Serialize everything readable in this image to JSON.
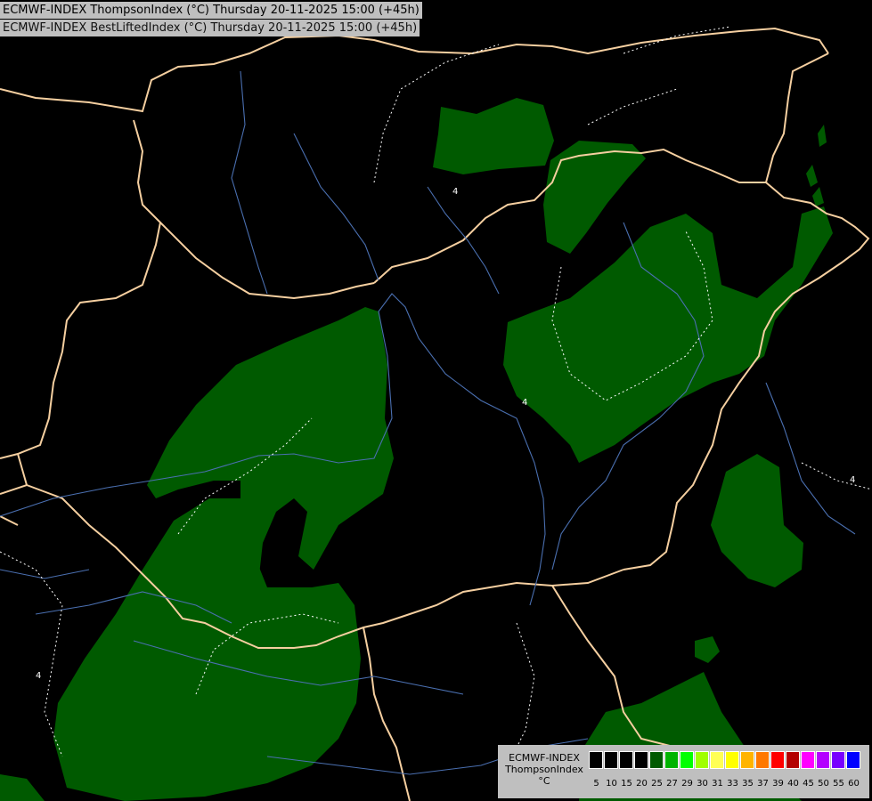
{
  "titles": {
    "line1": "ECMWF-INDEX ThompsonIndex (°C) Thursday 20-11-2025 15:00 (+45h)",
    "line2": "ECMWF-INDEX BestLiftedIndex (°C) Thursday 20-11-2025 15:00 (+45h)"
  },
  "legend": {
    "model": "ECMWF-INDEX",
    "variable": "ThompsonIndex",
    "unit": "°C",
    "ticks": [
      "5",
      "10",
      "15",
      "20",
      "25",
      "27",
      "29",
      "30",
      "31",
      "33",
      "35",
      "37",
      "39",
      "40",
      "45",
      "50",
      "55",
      "60"
    ],
    "colors": [
      "#000000",
      "#000000",
      "#000000",
      "#000000",
      "#005a00",
      "#00b400",
      "#00ff00",
      "#a0ff00",
      "#ffff55",
      "#ffff00",
      "#ffb400",
      "#ff7800",
      "#ff0000",
      "#b40000",
      "#ff00ff",
      "#b400ff",
      "#7800ff",
      "#0000ff"
    ]
  },
  "map": {
    "contour_label": "4",
    "colors": {
      "background": "#000000",
      "fill": "#005a00",
      "border": "#f5cfa0",
      "river": "#4a6fb0",
      "contour": "#ffffff"
    }
  }
}
